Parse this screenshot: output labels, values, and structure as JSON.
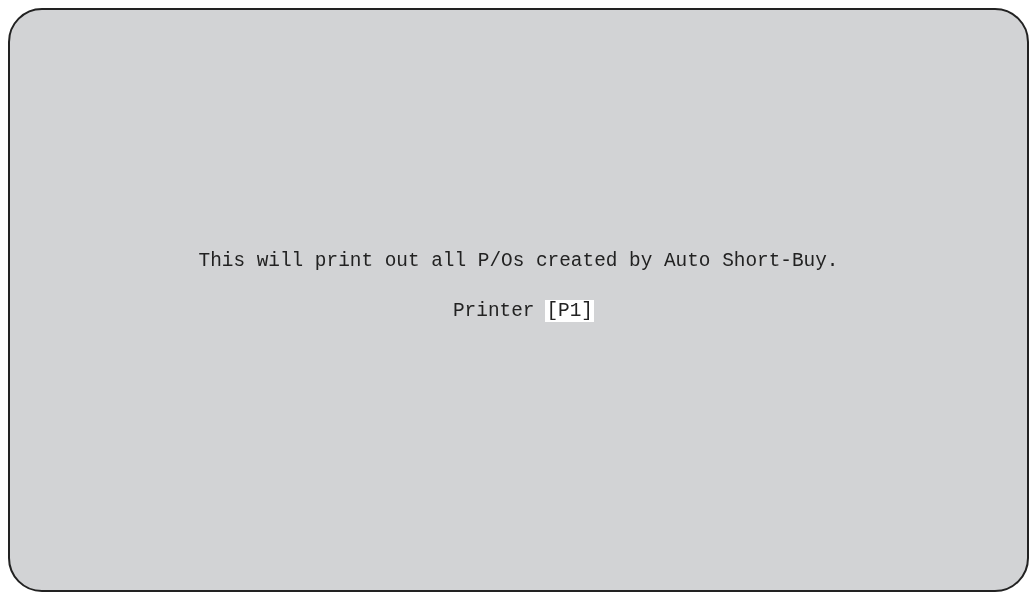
{
  "message": "This will print out all P/Os created by Auto Short-Buy.",
  "printer": {
    "label": "Printer",
    "value": "[P1]"
  }
}
